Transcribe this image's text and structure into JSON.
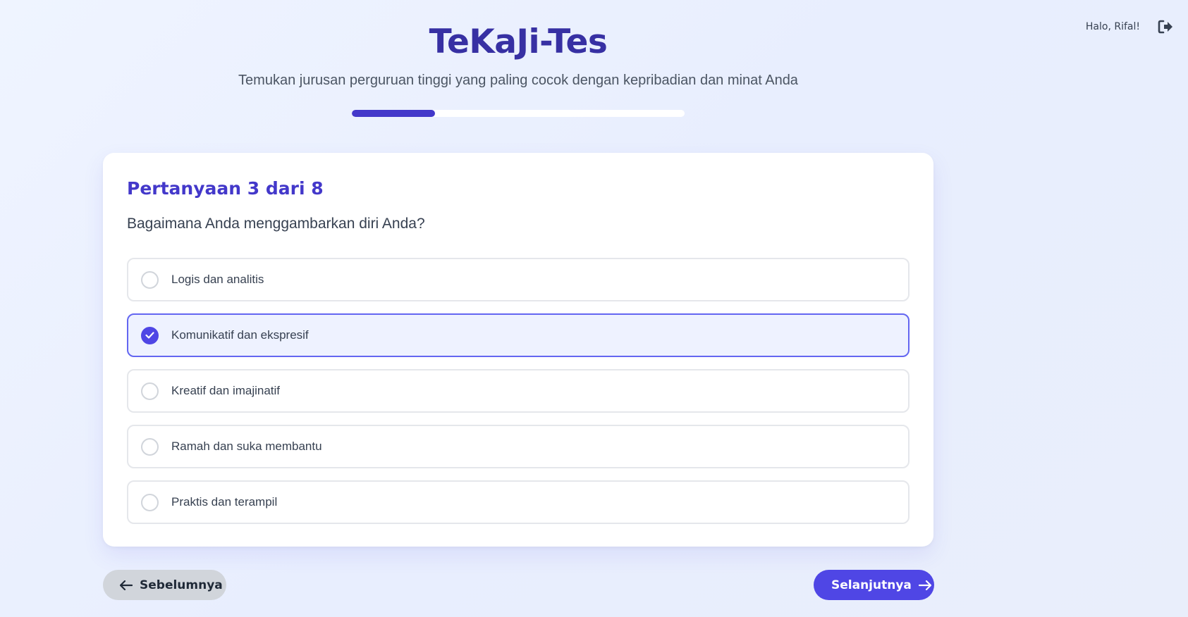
{
  "header": {
    "title": "TeKaJi-Tes",
    "subtitle": "Temukan jurusan perguruan tinggi yang paling cocok dengan kepribadian dan minat Anda"
  },
  "user": {
    "greeting": "Halo, Rifal!",
    "logout_icon": "logout-icon"
  },
  "progress": {
    "current": 3,
    "total": 8,
    "percent": 25,
    "color": "#4338ca"
  },
  "question": {
    "number_label": "Pertanyaan 3 dari 8",
    "text": "Bagaimana Anda menggambarkan diri Anda?",
    "options": [
      {
        "label": "Logis dan analitis",
        "selected": false
      },
      {
        "label": "Komunikatif dan ekspresif",
        "selected": true
      },
      {
        "label": "Kreatif dan imajinatif",
        "selected": false
      },
      {
        "label": "Ramah dan suka membantu",
        "selected": false
      },
      {
        "label": "Praktis dan terampil",
        "selected": false
      }
    ]
  },
  "nav": {
    "prev_label": "Sebelumnya",
    "next_label": "Selanjutnya"
  },
  "colors": {
    "accent": "#4f46e5",
    "title": "#3730a3",
    "selected_bg": "#eef2ff"
  }
}
